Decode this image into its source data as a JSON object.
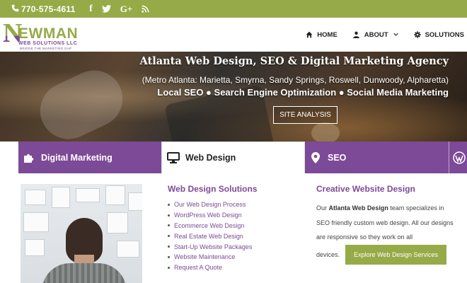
{
  "topbar": {
    "phone": "770-575-4611",
    "icons": [
      "phone-icon",
      "facebook-icon",
      "twitter-icon",
      "google-plus-icon",
      "rss-icon"
    ],
    "social_labels": {
      "facebook": "f",
      "google_plus": "G+"
    }
  },
  "logo": {
    "brand": "EWMAN",
    "initial": "N",
    "subtitle": "WEB SOLUTIONS LLC",
    "tagline": "BRIDGE THE MARKETING GAP"
  },
  "nav": {
    "home": "HOME",
    "about": "ABOUT",
    "solutions": "SOLUTIONS"
  },
  "hero": {
    "title": "Atlanta Web Design, SEO & Digital Marketing Agency",
    "subtitle": "(Metro Atlanta: Marietta, Smyrna, Sandy Springs, Roswell, Dunwoody, Alpharetta)",
    "services": "Local SEO ● Search Engine Optimization ● Social Media Marketing",
    "button": "SITE ANALYSIS"
  },
  "tabs": [
    {
      "label": "Digital Marketing",
      "icon": "puzzle-icon",
      "active": false
    },
    {
      "label": "Web Design",
      "icon": "monitor-icon",
      "active": true
    },
    {
      "label": "SEO",
      "icon": "location-pin-icon",
      "active": false
    },
    {
      "label": "",
      "icon": "wordpress-icon",
      "active": false
    }
  ],
  "web_design": {
    "heading": "Web Design Solutions",
    "links": [
      "Our Web Design Process",
      "WordPress Web Design",
      "Ecommerce Web Design",
      "Real Estate Web Design",
      "Start-Up Website Packages",
      "Website Maintenance",
      "Request A Quote"
    ]
  },
  "creative": {
    "heading": "Creative Website Design",
    "text_before": "Our ",
    "text_bold": "Atlanta Web Design",
    "text_after": " team specializes in SEO friendly custom web design. All our designs are responsive so they work on all",
    "text_end": "devices.",
    "button": "Explore Web Design Services"
  },
  "colors": {
    "green": "#96aa48",
    "purple": "#7d4a97"
  }
}
